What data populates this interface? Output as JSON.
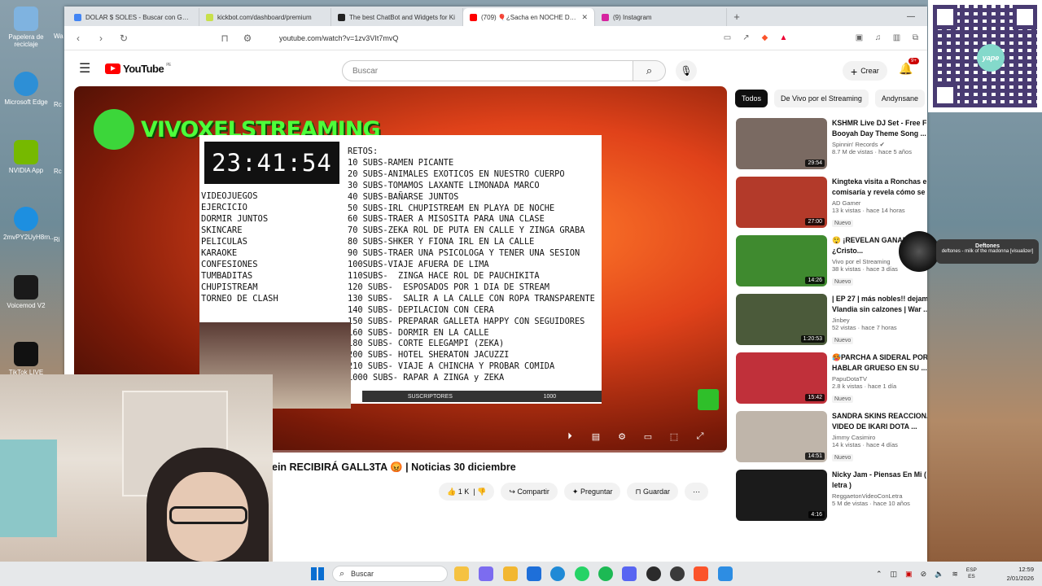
{
  "desktop": {
    "icons": [
      {
        "label": "Papelera de reciclaje",
        "color": "#7fb3e0"
      },
      {
        "label": "Microsoft Edge",
        "color": "#2d8fd6"
      },
      {
        "label": "NVIDIA App",
        "color": "#76b900"
      },
      {
        "label": "2mvPY2UyH8rn...",
        "color": "#1d8fe0"
      },
      {
        "label": "Voicemod V2",
        "color": "#1a1a1a"
      },
      {
        "label": "TikTok LIVE",
        "color": "#111111"
      }
    ],
    "side_labels": [
      "Wa",
      "Rc",
      "Rc",
      "Ri"
    ]
  },
  "browser": {
    "tabs": [
      {
        "title": "DOLAR $ SOLES - Buscar con Google",
        "fav_color": "#4285f4"
      },
      {
        "title": "kickbot.com/dashboard/premium",
        "fav_color": "#c8e04b"
      },
      {
        "title": "The best ChatBot and Widgets for Ki",
        "fav_color": "#222222"
      },
      {
        "title": "(709) 🎈¿Sacha en NOCHE DOR",
        "fav_color": "#ff0000",
        "active": true
      },
      {
        "title": "(9) Instagram",
        "fav_color": "#d6249f"
      }
    ],
    "new_tab": "+",
    "url": "youtube.com/watch?v=1zv3VIt7mvQ"
  },
  "youtube": {
    "logo_text": "YouTube",
    "country": "PE",
    "search_placeholder": "Buscar",
    "create_label": "Crear",
    "notif_count": "9+",
    "video_title": "ein RECIBIRÁ GALL3TA 😡 | Noticias 30 diciembre",
    "likes": "1 K",
    "share_label": "Compartir",
    "ask_label": "Preguntar",
    "save_label": "Guardar",
    "chips": [
      "Todos",
      "De Vivo por el Streaming",
      "Andynsane"
    ],
    "recommendations": [
      {
        "title": "KSHMR Live DJ Set - Free Fire Booyah Day Theme Song ...",
        "channel": "Spinnin' Records ✔",
        "views": "8.7 M de vistas · hace 5 años",
        "duration": "29:54",
        "thumb": "#7a6a62",
        "nuevo": ""
      },
      {
        "title": "Kingteka visita a Ronchas en la comisaría y revela cómo se ...",
        "channel": "AD Gamer",
        "views": "13 k vistas · hace 14 horas",
        "duration": "27:00",
        "thumb": "#b33a2a",
        "nuevo": "Nuevo"
      },
      {
        "title": "😲 ¡REVELAN GANAN... kick! 🔥 ¿Cristo...",
        "channel": "Vivo por el Streaming",
        "views": "38 k vistas · hace 3 días",
        "duration": "14:26",
        "thumb": "#3f8a2f",
        "nuevo": "Nuevo"
      },
      {
        "title": "| EP 27 | más nobles!! dejamos a Vlandia sin calzones | War ...",
        "channel": "Jinbey",
        "views": "52 vistas · hace 7 horas",
        "duration": "1:20:53",
        "thumb": "#4b5a3a",
        "nuevo": "Nuevo"
      },
      {
        "title": "🥵PARCHA A SIDERAL POR HABLAR GRUESO EN SU ...",
        "channel": "PapuDotaTV",
        "views": "2.8 k vistas · hace 1 día",
        "duration": "15:42",
        "thumb": "#c0303a",
        "nuevo": "Nuevo"
      },
      {
        "title": "SANDRA SKINS REACCIONA AL VIDEO DE IKARI DOTA ...",
        "channel": "Jimmy Casimiro",
        "views": "14 k vistas · hace 4 días",
        "duration": "14:51",
        "thumb": "#bfb5aa",
        "nuevo": "Nuevo"
      },
      {
        "title": "Nicky Jam - Piensas En Mi ( Con letra )",
        "channel": "ReggaetonVideoConLetra",
        "views": "5 M de vistas · hace 10 años",
        "duration": "4:16",
        "thumb": "#1b1b1b",
        "nuevo": ""
      }
    ]
  },
  "video_frame": {
    "channel_name": "VIVOXELSTREAMING",
    "timer": "23:41:54",
    "left_list": [
      "VIDEOJUEGOS",
      "EJERCICIO",
      "DORMIR JUNTOS",
      "SKINCARE",
      "PELICULAS",
      "KARAOKE",
      "CONFESIONES",
      "TUMBADITAS",
      "CHUPISTREAM",
      "TORNEO DE CLASH"
    ],
    "challenges": "RETOS:\n10 SUBS-RAMEN PICANTE\n20 SUBS-ANIMALES EXOTICOS EN NUESTRO CUERPO\n30 SUBS-TOMAMOS LAXANTE LIMONADA MARCO\n40 SUBS-BAÑARSE JUNTOS\n50 SUBS-IRL CHUPISTREAM EN PLAYA DE NOCHE\n60 SUBS-TRAER A MISOSITA PARA UNA CLASE\n70 SUBS-ZEKA ROL DE PUTA EN CALLE Y ZINGA GRABA\n80 SUBS-SHKER Y FIONA IRL EN LA CALLE\n90 SUBS-TRAER UNA PSICOLOGA Y TENER UNA SESION\n100SUBS-VIAJE AFUERA DE LIMA\n110SUBS-  ZINGA HACE ROL DE PAUCHIKITA\n120 SUBS-  ESPOSADOS POR 1 DIA DE STREAM\n130 SUBS-  SALIR A LA CALLE CON ROPA TRANSPARENTE\n140 SUBS- DEPILACION CON CERA\n150 SUBS- PREPARAR GALLETA HAPPY CON SEGUIDORES\n160 SUBS- DORMIR EN LA CALLE\n180 SUBS- CORTE ELEGAMPI (ZEKA)\n200 SUBS- HOTEL SHERATON JACUZZI\n210 SUBS- VIAJE A CHINCHA Y PROBAR COMIDA\n1000 SUBS- RAPAR A ZINGA y ZEKA",
    "footer_label": "SUSCRIPTORES",
    "footer_count": "1000"
  },
  "overlays": {
    "qr_brand": "yape",
    "music_artist": "Deftones",
    "music_track": "deftones - milk of the madonna [visualizer]"
  },
  "taskbar": {
    "search_placeholder": "Buscar",
    "apps": [
      {
        "name": "file-explorer",
        "color": "#f5c242"
      },
      {
        "name": "copilot",
        "color": "#7c6cf0"
      },
      {
        "name": "folder",
        "color": "#f2b731"
      },
      {
        "name": "store",
        "color": "#1e6fd9"
      },
      {
        "name": "edge",
        "color": "#1f8ad6"
      },
      {
        "name": "whatsapp",
        "color": "#25d366"
      },
      {
        "name": "spotify",
        "color": "#1db954"
      },
      {
        "name": "discord",
        "color": "#5865f2"
      },
      {
        "name": "obs",
        "color": "#2b2b2b"
      },
      {
        "name": "chrome",
        "color": "#3a3a3a"
      },
      {
        "name": "brave",
        "color": "#fb542b"
      },
      {
        "name": "notepad",
        "color": "#2d8de3"
      }
    ],
    "lang_top": "ESP",
    "lang_bottom": "ES",
    "time": "12:59",
    "date": "2/01/2026"
  }
}
